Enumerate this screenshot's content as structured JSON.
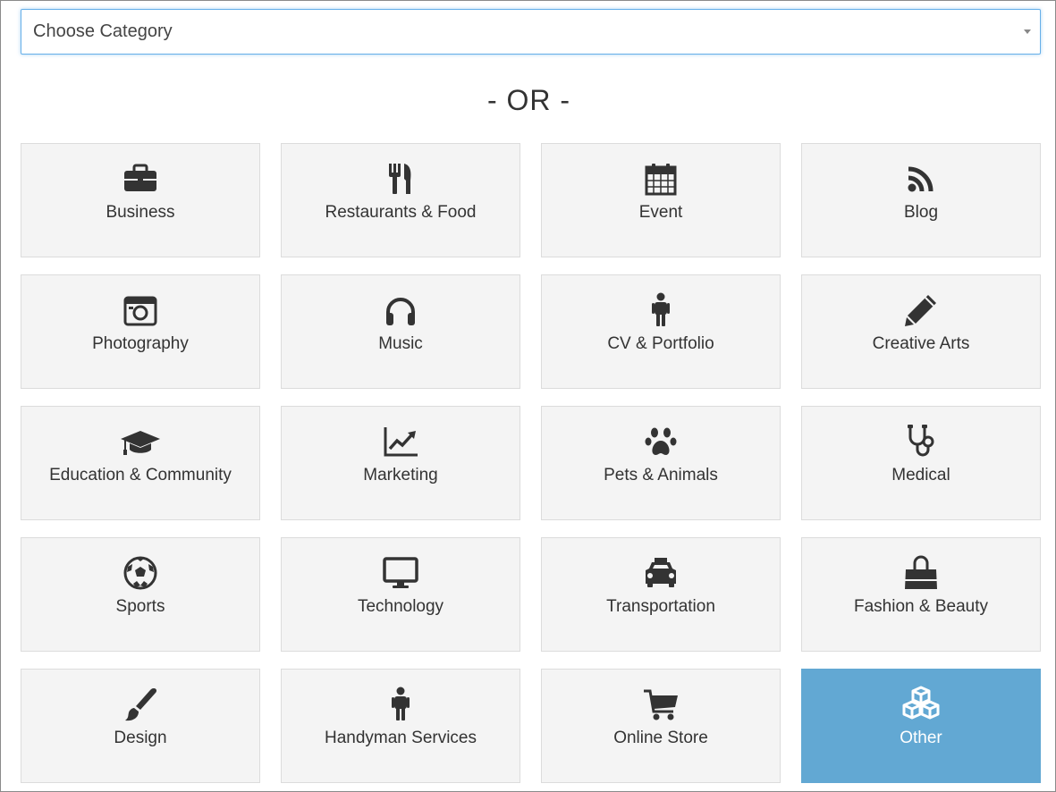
{
  "select": {
    "placeholder": "Choose Category"
  },
  "divider": {
    "text": "- OR -"
  },
  "accent_color": "#62a8d3",
  "categories": [
    {
      "label": "Business",
      "icon": "briefcase-icon"
    },
    {
      "label": "Restaurants & Food",
      "icon": "cutlery-icon"
    },
    {
      "label": "Event",
      "icon": "calendar-icon"
    },
    {
      "label": "Blog",
      "icon": "rss-icon"
    },
    {
      "label": "Photography",
      "icon": "camera-icon"
    },
    {
      "label": "Music",
      "icon": "headphones-icon"
    },
    {
      "label": "CV & Portfolio",
      "icon": "person-icon"
    },
    {
      "label": "Creative Arts",
      "icon": "pencil-icon"
    },
    {
      "label": "Education & Community",
      "icon": "graduation-cap-icon"
    },
    {
      "label": "Marketing",
      "icon": "line-chart-icon"
    },
    {
      "label": "Pets & Animals",
      "icon": "paw-icon"
    },
    {
      "label": "Medical",
      "icon": "stethoscope-icon"
    },
    {
      "label": "Sports",
      "icon": "soccer-ball-icon"
    },
    {
      "label": "Technology",
      "icon": "desktop-icon"
    },
    {
      "label": "Transportation",
      "icon": "taxi-icon"
    },
    {
      "label": "Fashion & Beauty",
      "icon": "shopping-bag-icon"
    },
    {
      "label": "Design",
      "icon": "paint-brush-icon"
    },
    {
      "label": "Handyman Services",
      "icon": "person-icon"
    },
    {
      "label": "Online Store",
      "icon": "shopping-cart-icon"
    },
    {
      "label": "Other",
      "icon": "cubes-icon",
      "selected": true
    }
  ]
}
